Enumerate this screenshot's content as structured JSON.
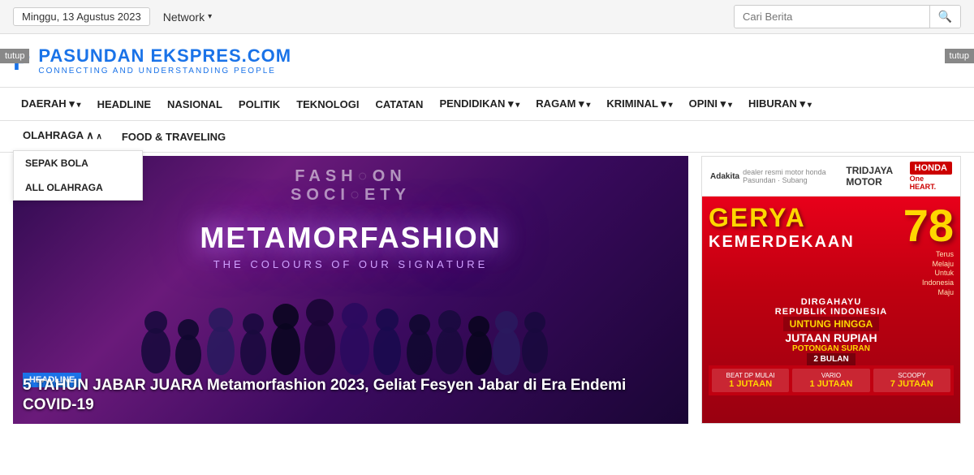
{
  "topbar": {
    "date": "Minggu, 13 Agustus 2023",
    "network_label": "Network",
    "search_placeholder": "Cari Berita",
    "tutup_label": "tutup"
  },
  "header": {
    "logo_letter": "P",
    "logo_title": "PASUNDAN EKSPRES.COM",
    "logo_subtitle": "CONNECTING AND UNDERSTANDING PEOPLE"
  },
  "main_nav": {
    "items": [
      {
        "label": "DAERAH",
        "has_dropdown": true
      },
      {
        "label": "HEADLINE",
        "has_dropdown": false
      },
      {
        "label": "NASIONAL",
        "has_dropdown": false
      },
      {
        "label": "POLITIK",
        "has_dropdown": false
      },
      {
        "label": "TEKNOLOGI",
        "has_dropdown": false
      },
      {
        "label": "CATATAN",
        "has_dropdown": false
      },
      {
        "label": "PENDIDIKAN",
        "has_dropdown": true
      },
      {
        "label": "RAGAM",
        "has_dropdown": true
      },
      {
        "label": "KRIMINAL",
        "has_dropdown": true
      },
      {
        "label": "OPINI",
        "has_dropdown": true
      },
      {
        "label": "HIBURAN",
        "has_dropdown": true
      }
    ]
  },
  "second_nav": {
    "items": [
      {
        "label": "OLAHRAGA",
        "has_dropdown": true,
        "active": true
      },
      {
        "label": "FOOD & TRAVELING",
        "has_dropdown": false,
        "active": false
      }
    ],
    "dropdown_items": [
      {
        "label": "SEPAK BOLA"
      },
      {
        "label": "ALL OLAHRAGA"
      }
    ]
  },
  "hero": {
    "fashion_text_1": "FASH  ON",
    "fashion_text_2": "SOCI  ETY",
    "main_title": "METAMORFASHION",
    "subtitle": "THE COLOURS OF OUR SIGNATURE",
    "badge": "HEADLINE",
    "caption": "5 TAHUN JABAR JUARA Metamorfashion 2023, Geliat Fesyen Jabar di Era Endemi COVID-19"
  },
  "ad": {
    "tridjaya": "TRIDJAYA MOTOR",
    "honda": "HONDA",
    "one_heart": "One HEART.",
    "gerakan": "GERYA",
    "kemerdekaan": "KEMERDEKAAN",
    "number": "78",
    "small1": "Terus\nMelaju\nUntuk\nIndonesia\nMaju",
    "dirgahayu": "DIRGAHAYU\nREPUBLIK INDONESIA",
    "untung": "UNTUNG HINGGA",
    "jutaan": "JUTAAN RUPIAH",
    "potong": "POTONGAN SURAN",
    "bulan": "2 BULAN",
    "price1_label": "BEAT DP MULAI",
    "price1_value": "1 JUTAAN",
    "price2_label": "VARIO",
    "price2_value": "1 JUTAAN",
    "price3_label": "SCOOPY",
    "price3_value": "7 JUTAAN"
  }
}
